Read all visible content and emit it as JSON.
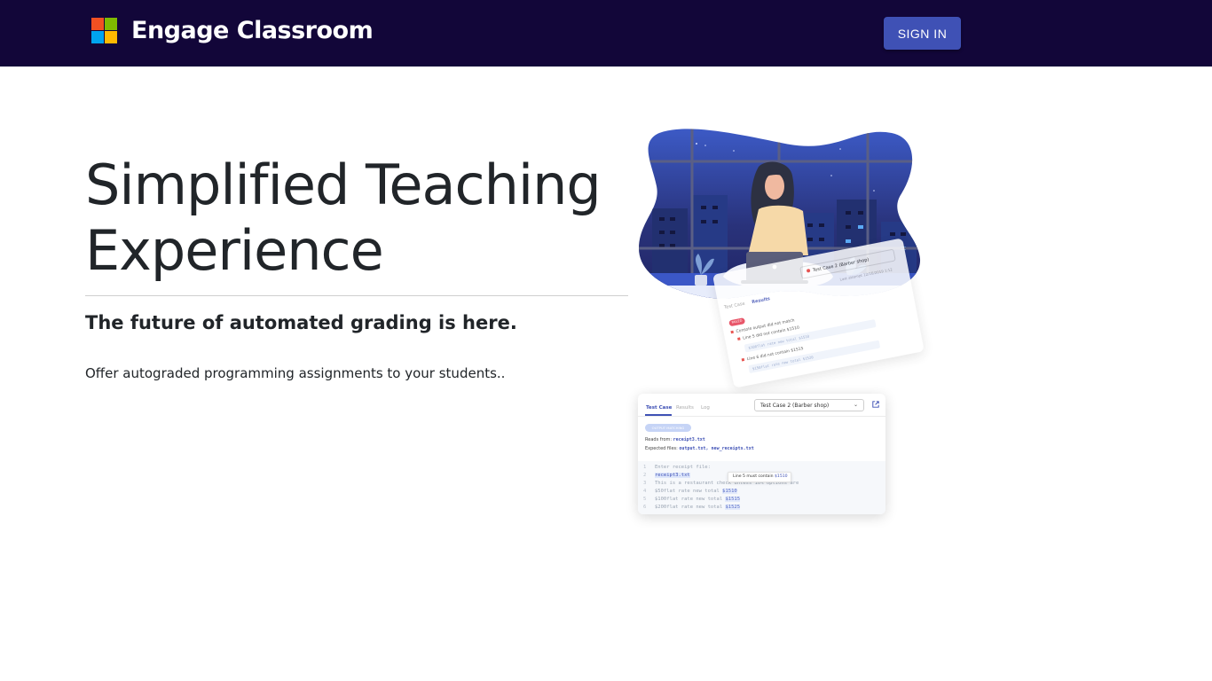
{
  "navbar": {
    "title": "Engage Classroom",
    "signin_label": "SIGN IN",
    "logo_colors": [
      "#f25022",
      "#7fba00",
      "#00a4ef",
      "#ffb900"
    ],
    "background": "#120639",
    "button_color": "#3f51b5"
  },
  "hero": {
    "title_line1": "Simplified Teaching",
    "title_line2": "Experience",
    "subtitle": "The future of automated grading is here.",
    "description": "Offer autograded programming assignments to your students.."
  },
  "illustration": {
    "back_card": {
      "test_case_select": "Test Case 2 (Barber shop)",
      "tabs": [
        "Test Case",
        "Results"
      ],
      "last_attempt": "Last attempt 12/16/2019 1:12",
      "failed_badge": "FAILED",
      "lines": [
        "Console output did not match",
        "Line 5 did not contain $1510",
        "Line 6 did not contain $1515"
      ],
      "codes": [
        "$100flat rate new total $1510",
        "$150flat rate new total $1520"
      ]
    },
    "front_card": {
      "tabs": [
        "Test Case",
        "Results",
        "Log"
      ],
      "test_case_select": "Test Case 2 (Barber shop)",
      "output_badge": "OUTPUT MATCHING",
      "reads_from_label": "Reads from:",
      "reads_from_file": "receipt3.txt",
      "expected_files_label": "Expected files:",
      "expected_files": "output.txt, new_receipts.txt",
      "code_lines": [
        {
          "num": "1",
          "text": "Enter receipt file:"
        },
        {
          "num": "2",
          "text": "receipt3.txt"
        },
        {
          "num": "3",
          "text": "This is a restaurant check unless 10% options are"
        },
        {
          "num": "4",
          "pre": "$50flat rate new total ",
          "amount": "$1510"
        },
        {
          "num": "5",
          "pre": "$100flat rate new total ",
          "amount": "$1515"
        },
        {
          "num": "6",
          "pre": "$200flat rate new total ",
          "amount": "$1525"
        }
      ],
      "tooltip_text": "Line 5 must contain ",
      "tooltip_amount": "$1510"
    }
  }
}
